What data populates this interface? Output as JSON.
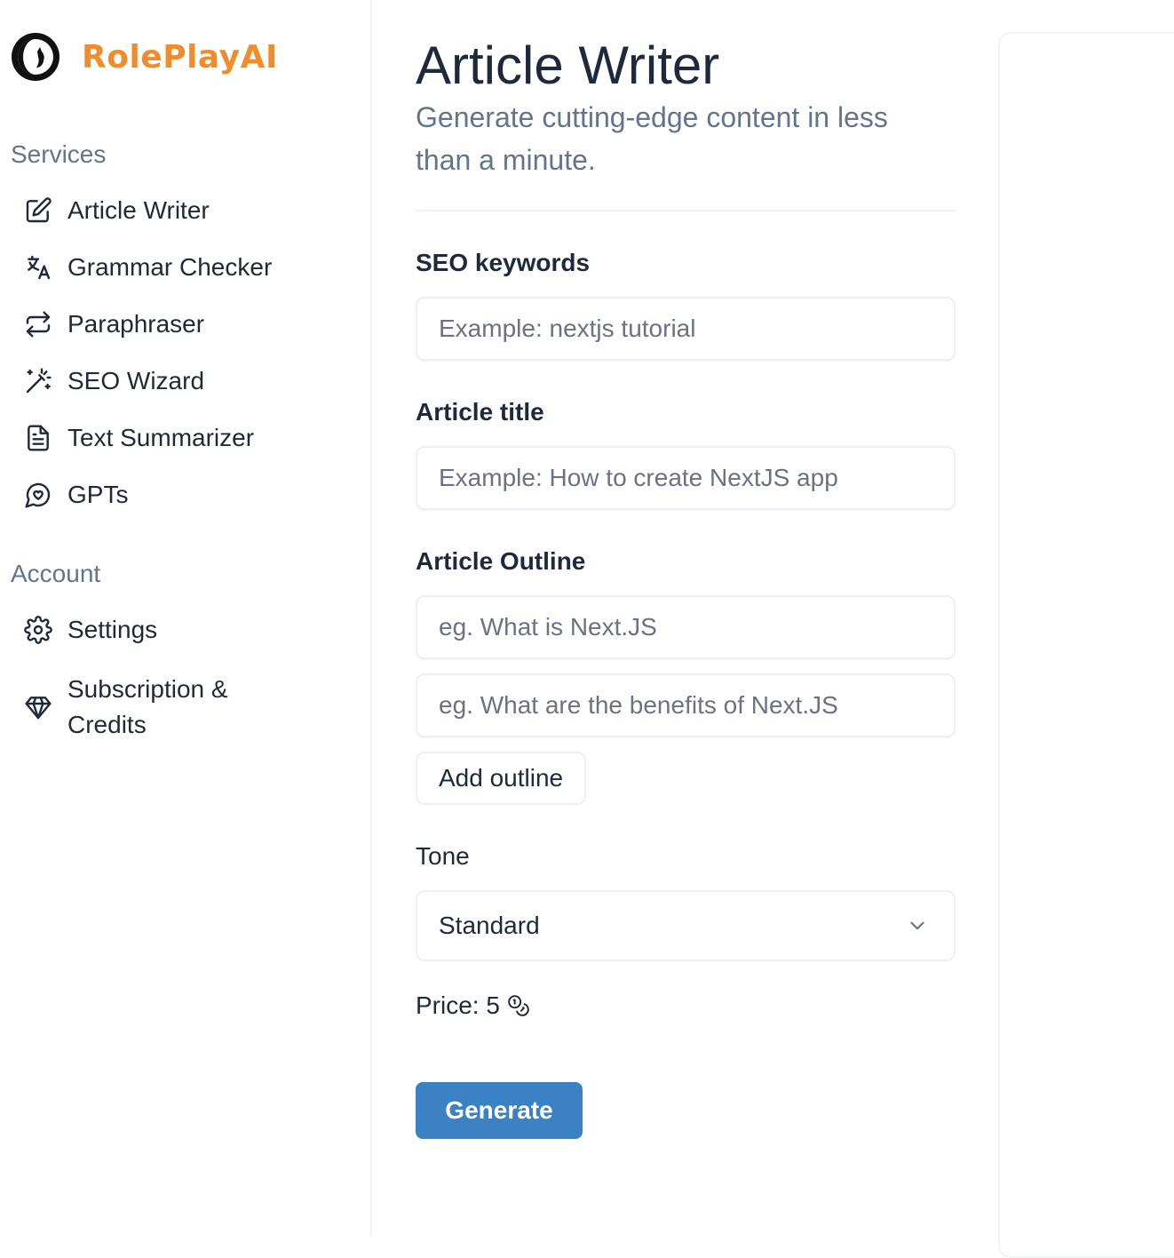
{
  "brand": {
    "name": "RolePlayAI",
    "color": "#f08c2c"
  },
  "sidebar": {
    "services_title": "Services",
    "services": [
      {
        "label": "Article Writer",
        "icon": "edit-icon"
      },
      {
        "label": "Grammar Checker",
        "icon": "translate-icon"
      },
      {
        "label": "Paraphraser",
        "icon": "repeat-icon"
      },
      {
        "label": "SEO Wizard",
        "icon": "magic-wand-icon"
      },
      {
        "label": "Text Summarizer",
        "icon": "file-text-icon"
      },
      {
        "label": "GPTs",
        "icon": "chat-heart-icon"
      }
    ],
    "account_title": "Account",
    "account": [
      {
        "label": "Settings",
        "icon": "gear-icon"
      },
      {
        "label": "Subscription & Credits",
        "icon": "diamond-icon"
      }
    ]
  },
  "main": {
    "title": "Article Writer",
    "subtitle": "Generate cutting-edge content in less than a minute.",
    "seo_label": "SEO keywords",
    "seo_placeholder": "Example: nextjs tutorial",
    "title_label": "Article title",
    "title_placeholder": "Example: How to create NextJS app",
    "outline_label": "Article Outline",
    "outline_placeholders": [
      "eg. What is Next.JS",
      "eg. What are the benefits of Next.JS"
    ],
    "add_outline": "Add outline",
    "tone_label": "Tone",
    "tone_value": "Standard",
    "price_text": "Price: 5",
    "generate": "Generate",
    "accent_color": "#3b82c4"
  }
}
